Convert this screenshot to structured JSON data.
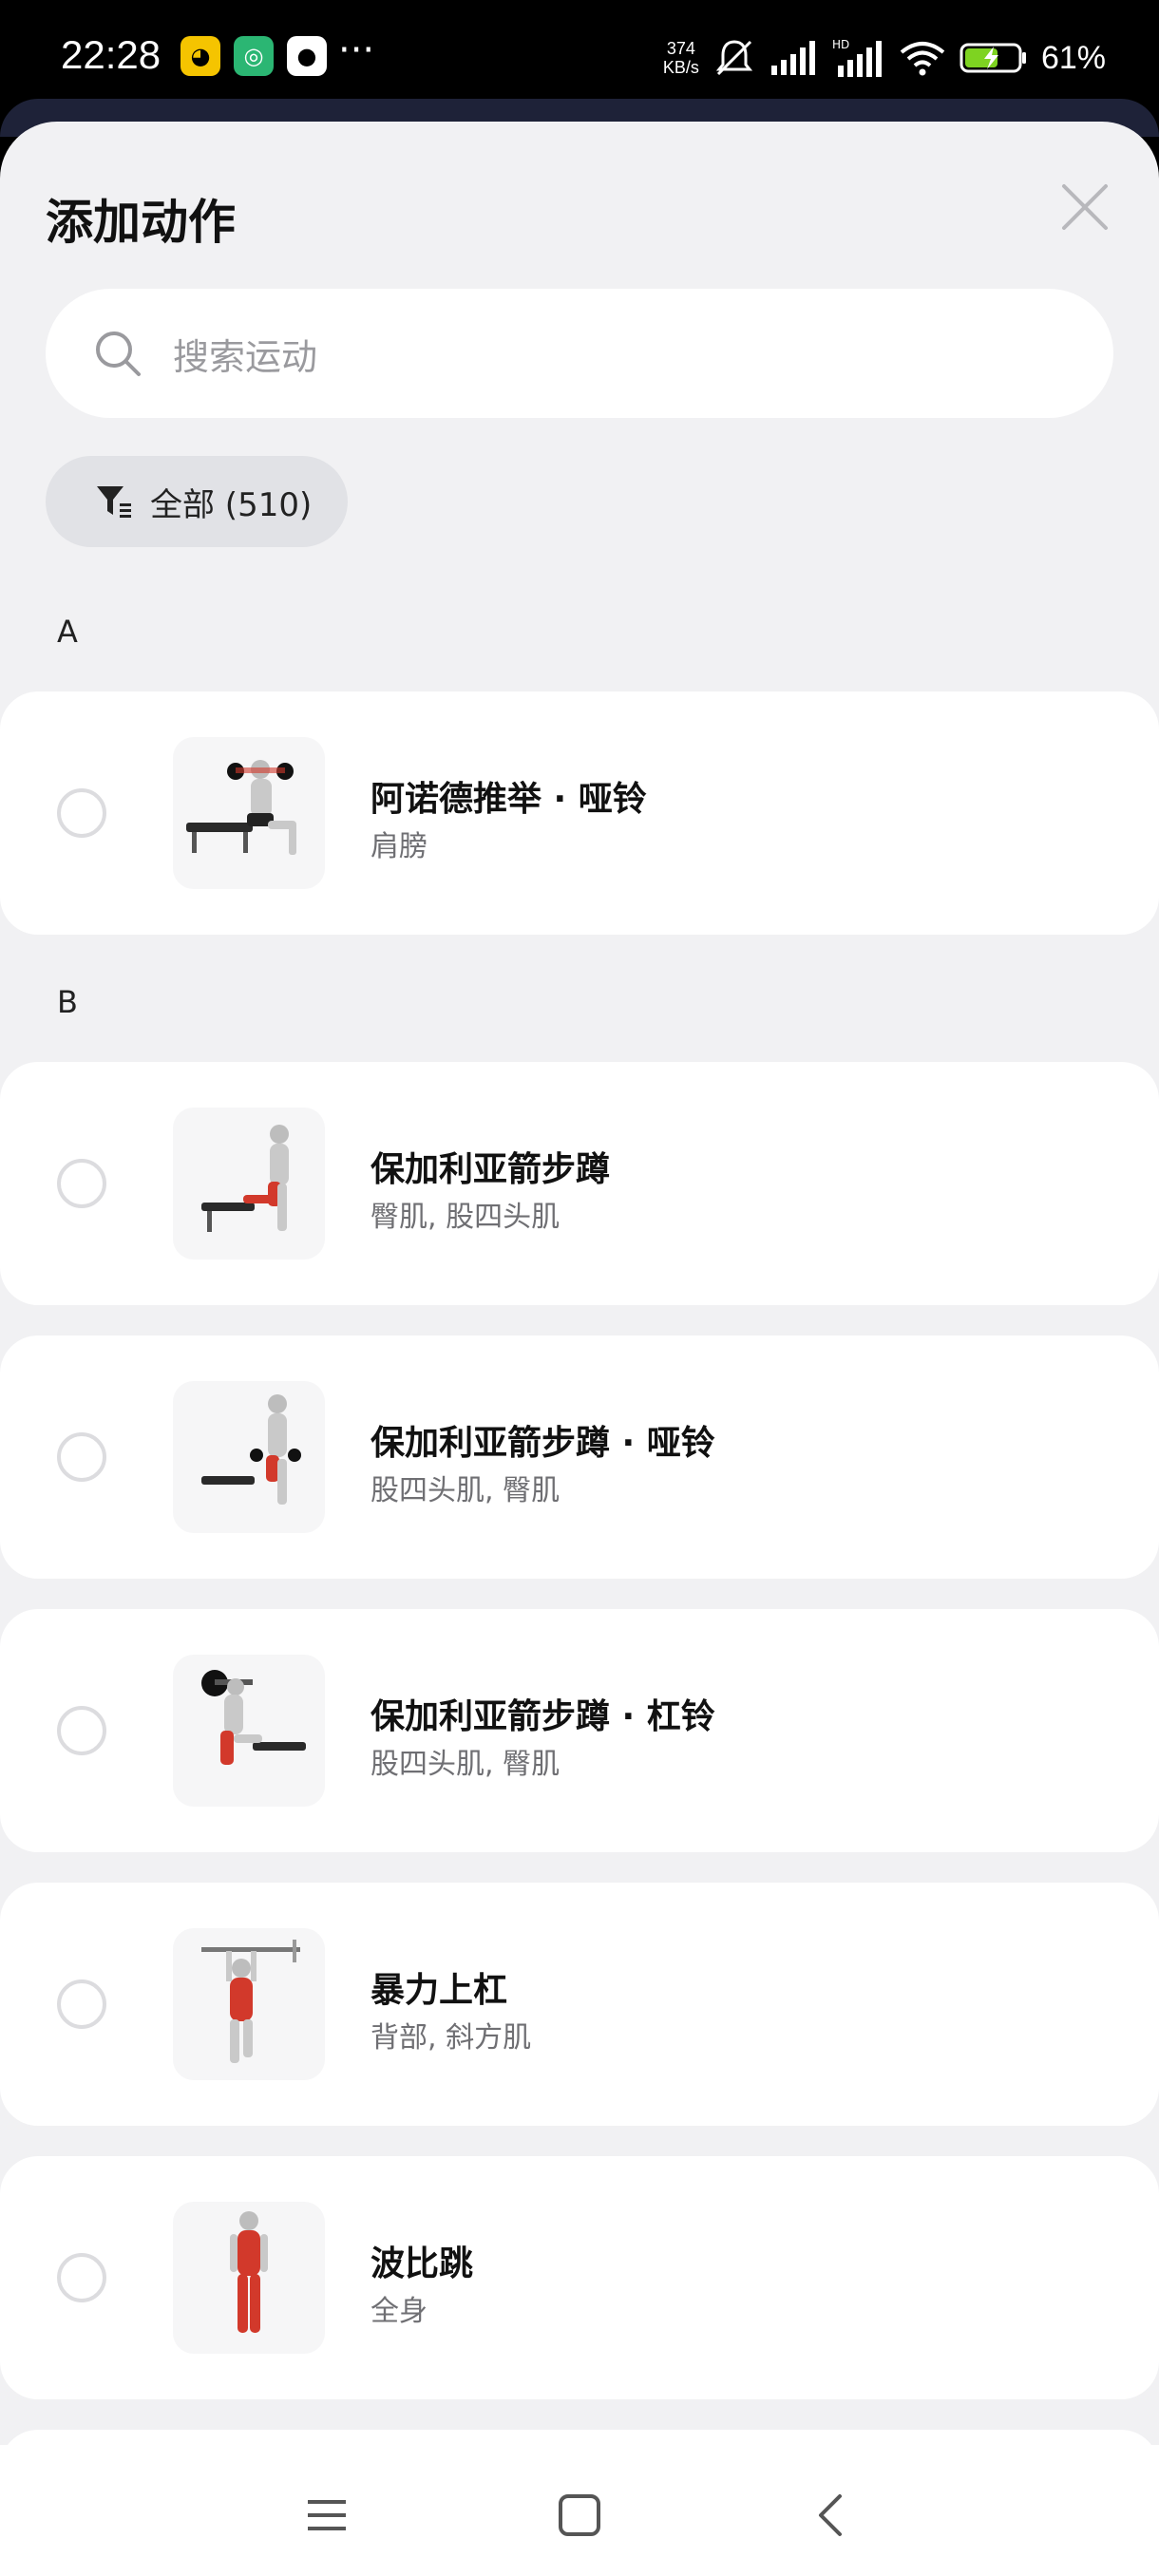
{
  "status_bar": {
    "time": "22:28",
    "net_speed_value": "374",
    "net_speed_unit": "KB/s",
    "battery_percent": "61%",
    "more": "···"
  },
  "sheet": {
    "title": "添加动作",
    "search": {
      "placeholder": "搜索运动"
    },
    "filter": {
      "label": "全部 (510)"
    }
  },
  "sections": [
    {
      "letter": "A",
      "exercises": [
        {
          "name": "阿诺德推举 · 哑铃",
          "muscles": "肩膀"
        }
      ]
    },
    {
      "letter": "B",
      "exercises": [
        {
          "name": "保加利亚箭步蹲",
          "muscles": "臀肌, 股四头肌"
        },
        {
          "name": "保加利亚箭步蹲 · 哑铃",
          "muscles": "股四头肌, 臀肌"
        },
        {
          "name": "保加利亚箭步蹲 · 杠铃",
          "muscles": "股四头肌, 臀肌"
        },
        {
          "name": "暴力上杠",
          "muscles": "背部, 斜方肌"
        },
        {
          "name": "波比跳",
          "muscles": "全身"
        }
      ]
    }
  ],
  "colors": {
    "accent_muscle": "#d2392b",
    "card_bg": "#ffffff",
    "sheet_bg": "#f1f1f3"
  }
}
